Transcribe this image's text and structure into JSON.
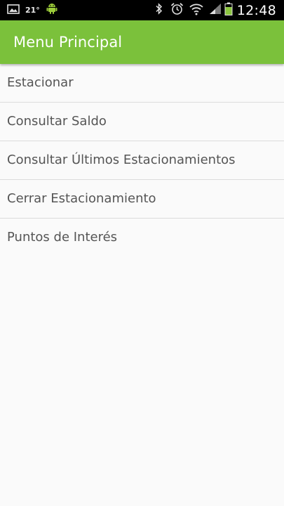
{
  "status_bar": {
    "temperature": "21°",
    "time": "12:48",
    "icons": [
      "gallery-icon",
      "android-icon",
      "bluetooth-icon",
      "alarm-icon",
      "wifi-icon",
      "signal-icon",
      "battery-icon"
    ],
    "background": "#000000"
  },
  "action_bar": {
    "title": "Menu Principal",
    "background": "#7bc13b"
  },
  "menu": {
    "items": [
      {
        "label": "Estacionar"
      },
      {
        "label": "Consultar Saldo"
      },
      {
        "label": "Consultar Últimos Estacionamientos"
      },
      {
        "label": "Cerrar Estacionamiento"
      },
      {
        "label": "Puntos de Interés"
      }
    ]
  }
}
